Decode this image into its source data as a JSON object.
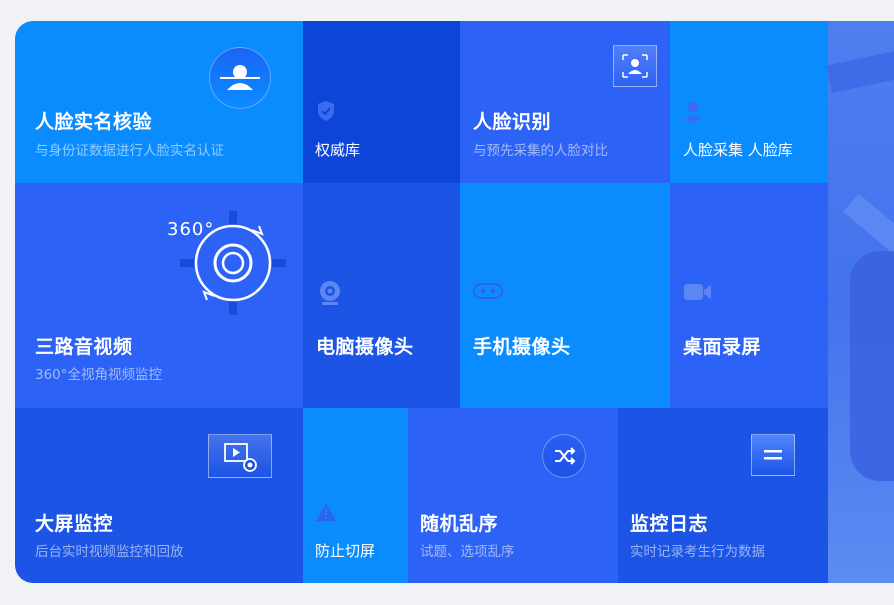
{
  "colors": {
    "bright_blue": "#0a8cff",
    "royal_blue": "#2d62f6",
    "deep_blue": "#1c54e6",
    "dark_blue": "#0d45d9",
    "mid_blue": "#2a5ef4"
  },
  "tiles": {
    "face_verify": {
      "title": "人脸实名核验",
      "subtitle": "与身份证数据进行人脸实名认证",
      "icon": "face-scan-icon"
    },
    "authority": {
      "label": "权威库",
      "icon": "shield-check-icon"
    },
    "face_recognition": {
      "title": "人脸识别",
      "subtitle": "与预先采集的人脸对比",
      "icon": "face-frame-icon"
    },
    "face_capture": {
      "label": "人脸采集 人脸库",
      "icon": "person-icon"
    },
    "three_way_av": {
      "title": "三路音视频",
      "subtitle": "360°全视角视频监控",
      "badge_text": "360°",
      "icon": "camera-360-icon"
    },
    "pc_camera": {
      "title": "电脑摄像头",
      "icon": "webcam-icon"
    },
    "phone_camera": {
      "title": "手机摄像头",
      "icon": "phone-camera-icon"
    },
    "screen_record": {
      "title": "桌面录屏",
      "icon": "video-camera-icon"
    },
    "big_screen": {
      "title": "大屏监控",
      "subtitle": "后台实时视频监控和回放",
      "icon": "screen-play-icon"
    },
    "anti_switch": {
      "label": "防止切屏",
      "icon": "warning-icon"
    },
    "shuffle": {
      "title": "随机乱序",
      "subtitle": "试题、选项乱序",
      "icon": "shuffle-icon"
    },
    "monitor_log": {
      "title": "监控日志",
      "subtitle": "实时记录考生行为数据",
      "icon": "log-icon"
    }
  }
}
